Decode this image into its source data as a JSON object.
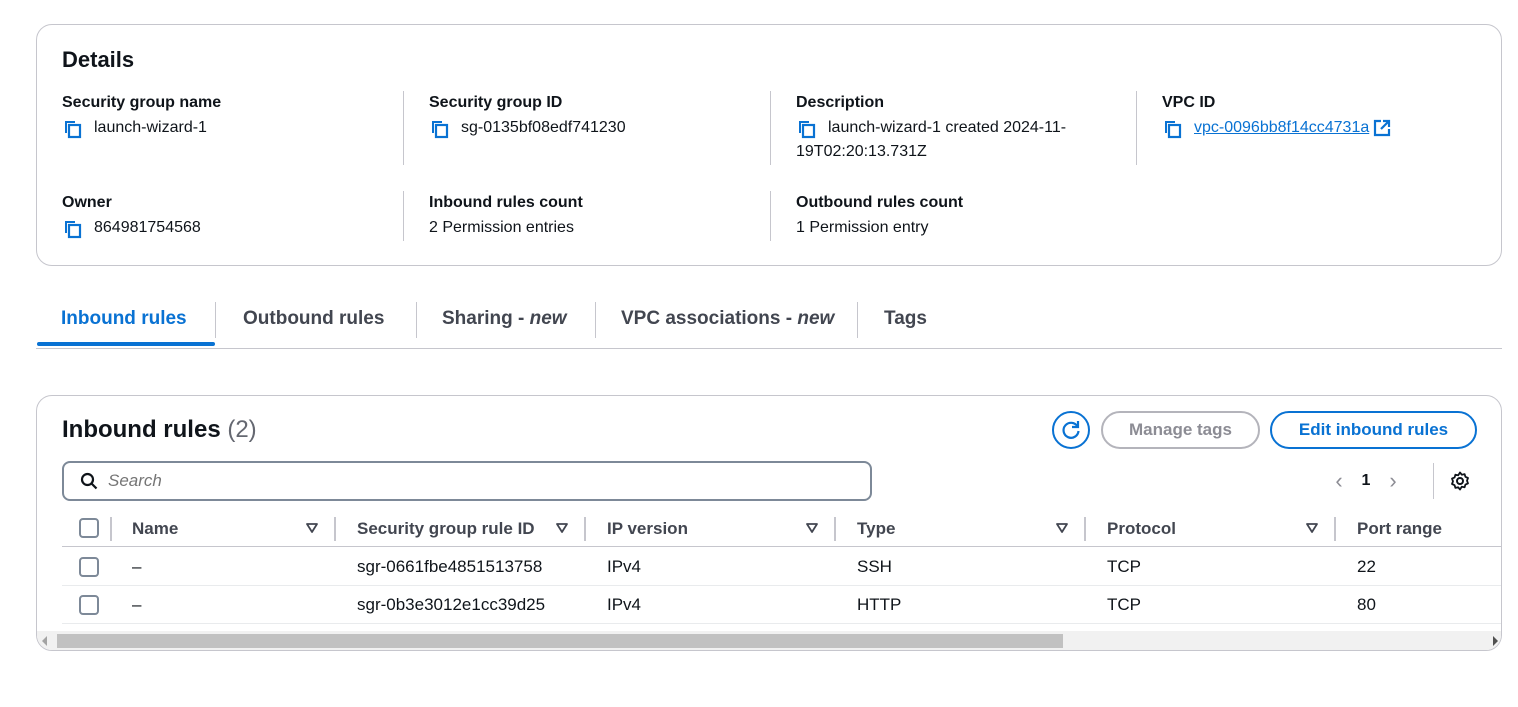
{
  "details": {
    "title": "Details",
    "security_group_name": {
      "label": "Security group name",
      "value": "launch-wizard-1"
    },
    "security_group_id": {
      "label": "Security group ID",
      "value": "sg-0135bf08edf741230"
    },
    "description": {
      "label": "Description",
      "value_line1": "launch-wizard-1 created 2024-11-",
      "value_line2": "19T02:20:13.731Z"
    },
    "vpc_id": {
      "label": "VPC ID",
      "value": "vpc-0096bb8f14cc4731a"
    },
    "owner": {
      "label": "Owner",
      "value": "864981754568"
    },
    "inbound_count": {
      "label": "Inbound rules count",
      "value": "2 Permission entries"
    },
    "outbound_count": {
      "label": "Outbound rules count",
      "value": "1 Permission entry"
    }
  },
  "tabs": [
    {
      "label": "Inbound rules",
      "suffix": ""
    },
    {
      "label": "Outbound rules",
      "suffix": ""
    },
    {
      "label": "Sharing - ",
      "suffix": "new"
    },
    {
      "label": "VPC associations - ",
      "suffix": "new"
    },
    {
      "label": "Tags",
      "suffix": ""
    }
  ],
  "rules": {
    "title": "Inbound rules",
    "count": "(2)",
    "manage_tags": "Manage tags",
    "edit_button": "Edit inbound rules",
    "search_placeholder": "Search",
    "page": "1",
    "columns": [
      "Name",
      "Security group rule ID",
      "IP version",
      "Type",
      "Protocol",
      "Port range"
    ],
    "rows": [
      [
        "–",
        "sgr-0661fbe4851513758",
        "IPv4",
        "SSH",
        "TCP",
        "22"
      ],
      [
        "–",
        "sgr-0b3e3012e1cc39d25",
        "IPv4",
        "HTTP",
        "TCP",
        "80"
      ]
    ]
  },
  "colors": {
    "accent": "#0972d3",
    "border": "#c6c6cd",
    "text": "#0f141a"
  },
  "icons": [
    "copy-icon",
    "external-link-icon",
    "refresh-icon",
    "search-icon",
    "chevron-left-icon",
    "chevron-right-icon",
    "gear-icon",
    "sort-down-icon"
  ]
}
